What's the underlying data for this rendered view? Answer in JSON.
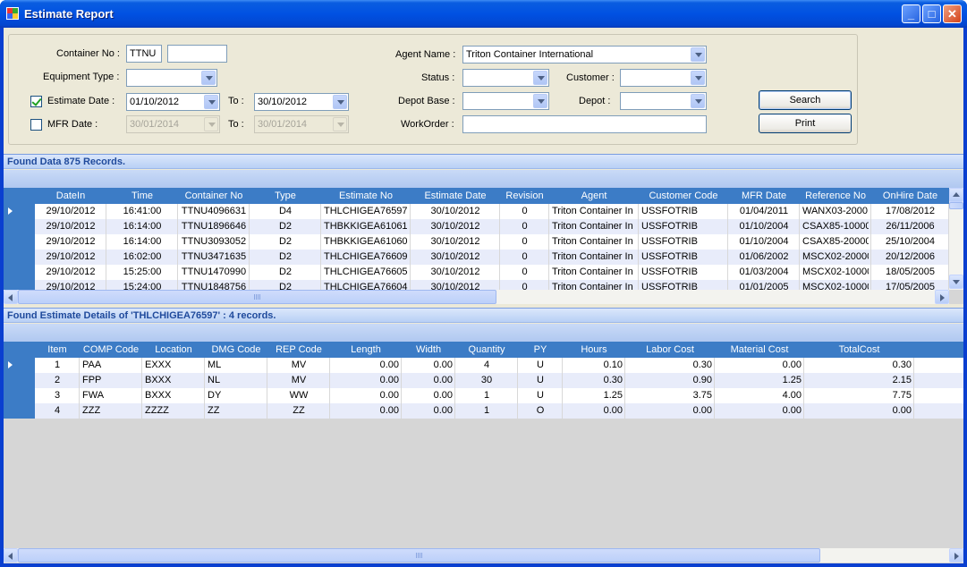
{
  "window": {
    "title": "Estimate Report"
  },
  "filters": {
    "container_no_label": "Container No :",
    "container_prefix": "TTNU",
    "container_number": "",
    "equipment_type_label": "Equipment Type :",
    "equipment_type": "",
    "estimate_date_label": "Estimate Date :",
    "estimate_date_checked": true,
    "estimate_from": "01/10/2012",
    "to_label": "To :",
    "estimate_to": "30/10/2012",
    "mfr_date_label": "MFR Date :",
    "mfr_date_checked": false,
    "mfr_from": "30/01/2014",
    "mfr_to": "30/01/2014",
    "agent_name_label": "Agent Name :",
    "agent_name": "Triton Container International",
    "status_label": "Status :",
    "status": "",
    "customer_label": "Customer :",
    "customer": "",
    "depot_base_label": "Depot Base :",
    "depot_base": "",
    "depot_label": "Depot :",
    "depot": "",
    "workorder_label": "WorkOrder :",
    "workorder": "",
    "search_label": "Search",
    "print_label": "Print"
  },
  "estimates": {
    "found_text": "Found Data 875 Records.",
    "columns": [
      "DateIn",
      "Time",
      "Container No",
      "Type",
      "Estimate No",
      "Estimate Date",
      "Revision",
      "Agent",
      "Customer Code",
      "MFR Date",
      "Reference No",
      "OnHire Date"
    ],
    "rows": [
      [
        "29/10/2012",
        "16:41:00",
        "TTNU4096631",
        "D4",
        "THLCHIGEA76597",
        "30/10/2012",
        "0",
        "Triton Container In",
        "USSFOTRIB",
        "01/04/2011",
        "WANX03-2000",
        "17/08/2012"
      ],
      [
        "29/10/2012",
        "16:14:00",
        "TTNU1896646",
        "D2",
        "THBKKIGEA61061",
        "30/10/2012",
        "0",
        "Triton Container In",
        "USSFOTRIB",
        "01/10/2004",
        "CSAX85-10000",
        "26/11/2006"
      ],
      [
        "29/10/2012",
        "16:14:00",
        "TTNU3093052",
        "D2",
        "THBKKIGEA61060",
        "30/10/2012",
        "0",
        "Triton Container In",
        "USSFOTRIB",
        "01/10/2004",
        "CSAX85-20000",
        "25/10/2004"
      ],
      [
        "29/10/2012",
        "16:02:00",
        "TTNU3471635",
        "D2",
        "THLCHIGEA76609",
        "30/10/2012",
        "0",
        "Triton Container In",
        "USSFOTRIB",
        "01/06/2002",
        "MSCX02-20000",
        "20/12/2006"
      ],
      [
        "29/10/2012",
        "15:25:00",
        "TTNU1470990",
        "D2",
        "THLCHIGEA76605",
        "30/10/2012",
        "0",
        "Triton Container In",
        "USSFOTRIB",
        "01/03/2004",
        "MSCX02-10000",
        "18/05/2005"
      ],
      [
        "29/10/2012",
        "15:24:00",
        "TTNU1848756",
        "D2",
        "THLCHIGEA76604",
        "30/10/2012",
        "0",
        "Triton Container In",
        "USSFOTRIB",
        "01/01/2005",
        "MSCX02-10000",
        "17/05/2005"
      ]
    ]
  },
  "details": {
    "found_text": "Found Estimate Details of 'THLCHIGEA76597' : 4 records.",
    "columns": [
      "Item",
      "COMP Code",
      "Location",
      "DMG Code",
      "REP Code",
      "Length",
      "Width",
      "Quantity",
      "PY",
      "Hours",
      "Labor Cost",
      "Material Cost",
      "TotalCost"
    ],
    "rows": [
      [
        "1",
        "PAA",
        "EXXX",
        "ML",
        "MV",
        "0.00",
        "0.00",
        "4",
        "U",
        "0.10",
        "0.30",
        "0.00",
        "0.30"
      ],
      [
        "2",
        "FPP",
        "BXXX",
        "NL",
        "MV",
        "0.00",
        "0.00",
        "30",
        "U",
        "0.30",
        "0.90",
        "1.25",
        "2.15"
      ],
      [
        "3",
        "FWA",
        "BXXX",
        "DY",
        "WW",
        "0.00",
        "0.00",
        "1",
        "U",
        "1.25",
        "3.75",
        "4.00",
        "7.75"
      ],
      [
        "4",
        "ZZZ",
        "ZZZZ",
        "ZZ",
        "ZZ",
        "0.00",
        "0.00",
        "1",
        "O",
        "0.00",
        "0.00",
        "0.00",
        "0.00"
      ]
    ]
  }
}
